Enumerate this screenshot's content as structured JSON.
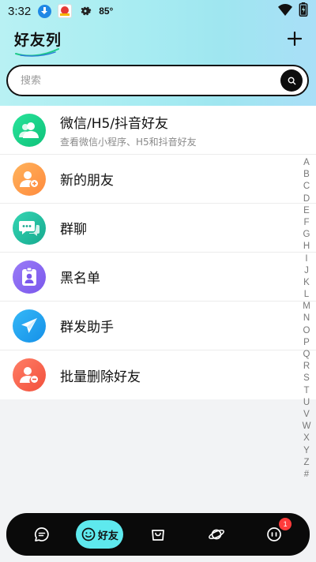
{
  "status_bar": {
    "time": "3:32",
    "temperature": "85°",
    "icons": [
      "download-icon",
      "app-badge-icon",
      "settings-icon",
      "wifi-icon",
      "battery-icon"
    ]
  },
  "header": {
    "title": "好友列",
    "add_icon": "plus-icon"
  },
  "search": {
    "placeholder": "搜索",
    "button_icon": "search-icon"
  },
  "items": [
    {
      "label": "微信/H5/抖音好友",
      "sub": "查看微信小程序、H5和抖音好友",
      "icon": "users-icon",
      "color": "#1dd38a"
    },
    {
      "label": "新的朋友",
      "icon": "add-user-icon",
      "color": "#ff9f43"
    },
    {
      "label": "群聊",
      "icon": "chat-bubbles-icon",
      "color": "#22c3a6"
    },
    {
      "label": "黑名单",
      "icon": "id-badge-icon",
      "color": "#8b6cf0"
    },
    {
      "label": "群发助手",
      "icon": "paper-plane-icon",
      "color": "#1ea7f0"
    },
    {
      "label": "批量删除好友",
      "icon": "remove-user-icon",
      "color": "#ff6b57"
    }
  ],
  "index_letters": [
    "A",
    "B",
    "C",
    "D",
    "E",
    "F",
    "G",
    "H",
    "I",
    "J",
    "K",
    "L",
    "M",
    "N",
    "O",
    "P",
    "Q",
    "R",
    "S",
    "T",
    "U",
    "V",
    "W",
    "X",
    "Y",
    "Z",
    "#"
  ],
  "bottom_nav": {
    "items": [
      {
        "icon": "message-icon"
      },
      {
        "icon": "smile-icon",
        "label": "好友",
        "active": true
      },
      {
        "icon": "shopping-bag-icon"
      },
      {
        "icon": "planet-icon"
      },
      {
        "icon": "more-icon",
        "badge": "1"
      }
    ]
  },
  "colors": {
    "accent": "#5ee9ee",
    "nav_bg": "#0a0a0a",
    "badge": "#ff3b3b"
  }
}
